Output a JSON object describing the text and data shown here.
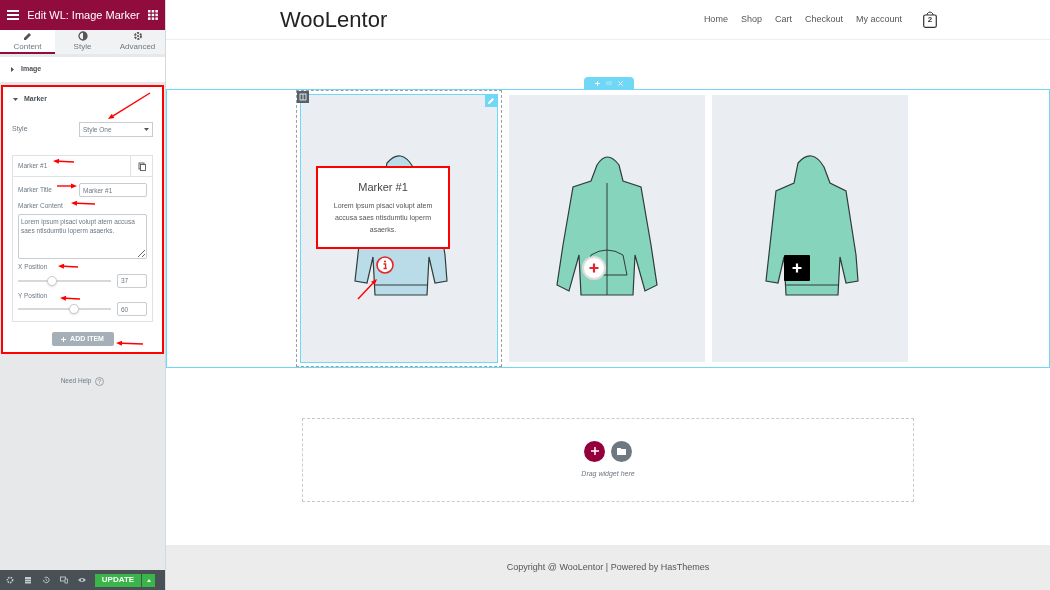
{
  "panel": {
    "title": "Edit WL: Image Marker",
    "tabs": [
      {
        "label": "Content",
        "selected": true
      },
      {
        "label": "Style",
        "selected": false
      },
      {
        "label": "Advanced",
        "selected": false
      }
    ],
    "sections": [
      {
        "label": "Image",
        "expanded": false
      },
      {
        "label": "Marker",
        "expanded": true
      }
    ],
    "style_field": {
      "label": "Style",
      "value": "Style One"
    },
    "repeater_item": {
      "title": "Marker #1",
      "title_field": {
        "label": "Marker Title",
        "value": "Marker #1"
      },
      "content_field": {
        "label": "Marker Content",
        "value": "Lorem ipsum pisaci volupt atem accusa saes ntisdumtiu loperm asaerks."
      },
      "sliders": [
        {
          "label": "X Position",
          "level": 0.37,
          "value": "37"
        },
        {
          "label": "Y Position",
          "level": 0.6,
          "value": "60"
        }
      ]
    },
    "add_item": "ADD ITEM",
    "need_help": "Need Help",
    "update": "UPDATE"
  },
  "site": {
    "logo": "WooLentor",
    "nav": [
      "Home",
      "Shop",
      "Cart",
      "Checkout",
      "My account"
    ],
    "cart_count": "2",
    "products": [
      {
        "kind": "info",
        "selected": true,
        "popup": {
          "title": "Marker #1",
          "text": "Lorem ipsum pisaci volupt atem accusa saes ntisdumtiu loperm asaerks."
        }
      },
      {
        "kind": "circle",
        "selected": false
      },
      {
        "kind": "square",
        "selected": false
      }
    ],
    "drop_zone": "Drag widget here",
    "footer": "Copyright @ WooLentor | Powered by HasThemes"
  }
}
